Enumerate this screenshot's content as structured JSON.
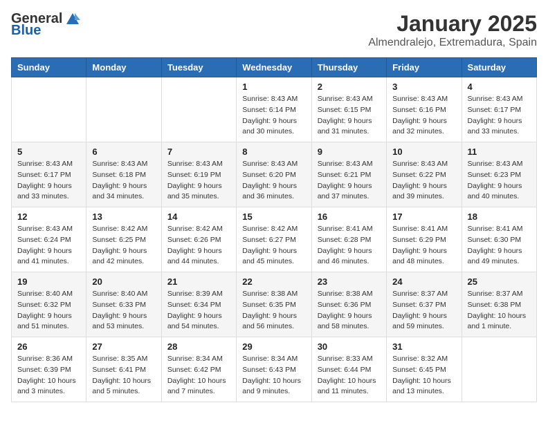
{
  "logo": {
    "general": "General",
    "blue": "Blue"
  },
  "title": "January 2025",
  "subtitle": "Almendralejo, Extremadura, Spain",
  "days_of_week": [
    "Sunday",
    "Monday",
    "Tuesday",
    "Wednesday",
    "Thursday",
    "Friday",
    "Saturday"
  ],
  "weeks": [
    [
      {
        "day": "",
        "info": ""
      },
      {
        "day": "",
        "info": ""
      },
      {
        "day": "",
        "info": ""
      },
      {
        "day": "1",
        "info": "Sunrise: 8:43 AM\nSunset: 6:14 PM\nDaylight: 9 hours and 30 minutes."
      },
      {
        "day": "2",
        "info": "Sunrise: 8:43 AM\nSunset: 6:15 PM\nDaylight: 9 hours and 31 minutes."
      },
      {
        "day": "3",
        "info": "Sunrise: 8:43 AM\nSunset: 6:16 PM\nDaylight: 9 hours and 32 minutes."
      },
      {
        "day": "4",
        "info": "Sunrise: 8:43 AM\nSunset: 6:17 PM\nDaylight: 9 hours and 33 minutes."
      }
    ],
    [
      {
        "day": "5",
        "info": "Sunrise: 8:43 AM\nSunset: 6:17 PM\nDaylight: 9 hours and 33 minutes."
      },
      {
        "day": "6",
        "info": "Sunrise: 8:43 AM\nSunset: 6:18 PM\nDaylight: 9 hours and 34 minutes."
      },
      {
        "day": "7",
        "info": "Sunrise: 8:43 AM\nSunset: 6:19 PM\nDaylight: 9 hours and 35 minutes."
      },
      {
        "day": "8",
        "info": "Sunrise: 8:43 AM\nSunset: 6:20 PM\nDaylight: 9 hours and 36 minutes."
      },
      {
        "day": "9",
        "info": "Sunrise: 8:43 AM\nSunset: 6:21 PM\nDaylight: 9 hours and 37 minutes."
      },
      {
        "day": "10",
        "info": "Sunrise: 8:43 AM\nSunset: 6:22 PM\nDaylight: 9 hours and 39 minutes."
      },
      {
        "day": "11",
        "info": "Sunrise: 8:43 AM\nSunset: 6:23 PM\nDaylight: 9 hours and 40 minutes."
      }
    ],
    [
      {
        "day": "12",
        "info": "Sunrise: 8:43 AM\nSunset: 6:24 PM\nDaylight: 9 hours and 41 minutes."
      },
      {
        "day": "13",
        "info": "Sunrise: 8:42 AM\nSunset: 6:25 PM\nDaylight: 9 hours and 42 minutes."
      },
      {
        "day": "14",
        "info": "Sunrise: 8:42 AM\nSunset: 6:26 PM\nDaylight: 9 hours and 44 minutes."
      },
      {
        "day": "15",
        "info": "Sunrise: 8:42 AM\nSunset: 6:27 PM\nDaylight: 9 hours and 45 minutes."
      },
      {
        "day": "16",
        "info": "Sunrise: 8:41 AM\nSunset: 6:28 PM\nDaylight: 9 hours and 46 minutes."
      },
      {
        "day": "17",
        "info": "Sunrise: 8:41 AM\nSunset: 6:29 PM\nDaylight: 9 hours and 48 minutes."
      },
      {
        "day": "18",
        "info": "Sunrise: 8:41 AM\nSunset: 6:30 PM\nDaylight: 9 hours and 49 minutes."
      }
    ],
    [
      {
        "day": "19",
        "info": "Sunrise: 8:40 AM\nSunset: 6:32 PM\nDaylight: 9 hours and 51 minutes."
      },
      {
        "day": "20",
        "info": "Sunrise: 8:40 AM\nSunset: 6:33 PM\nDaylight: 9 hours and 53 minutes."
      },
      {
        "day": "21",
        "info": "Sunrise: 8:39 AM\nSunset: 6:34 PM\nDaylight: 9 hours and 54 minutes."
      },
      {
        "day": "22",
        "info": "Sunrise: 8:38 AM\nSunset: 6:35 PM\nDaylight: 9 hours and 56 minutes."
      },
      {
        "day": "23",
        "info": "Sunrise: 8:38 AM\nSunset: 6:36 PM\nDaylight: 9 hours and 58 minutes."
      },
      {
        "day": "24",
        "info": "Sunrise: 8:37 AM\nSunset: 6:37 PM\nDaylight: 9 hours and 59 minutes."
      },
      {
        "day": "25",
        "info": "Sunrise: 8:37 AM\nSunset: 6:38 PM\nDaylight: 10 hours and 1 minute."
      }
    ],
    [
      {
        "day": "26",
        "info": "Sunrise: 8:36 AM\nSunset: 6:39 PM\nDaylight: 10 hours and 3 minutes."
      },
      {
        "day": "27",
        "info": "Sunrise: 8:35 AM\nSunset: 6:41 PM\nDaylight: 10 hours and 5 minutes."
      },
      {
        "day": "28",
        "info": "Sunrise: 8:34 AM\nSunset: 6:42 PM\nDaylight: 10 hours and 7 minutes."
      },
      {
        "day": "29",
        "info": "Sunrise: 8:34 AM\nSunset: 6:43 PM\nDaylight: 10 hours and 9 minutes."
      },
      {
        "day": "30",
        "info": "Sunrise: 8:33 AM\nSunset: 6:44 PM\nDaylight: 10 hours and 11 minutes."
      },
      {
        "day": "31",
        "info": "Sunrise: 8:32 AM\nSunset: 6:45 PM\nDaylight: 10 hours and 13 minutes."
      },
      {
        "day": "",
        "info": ""
      }
    ]
  ]
}
